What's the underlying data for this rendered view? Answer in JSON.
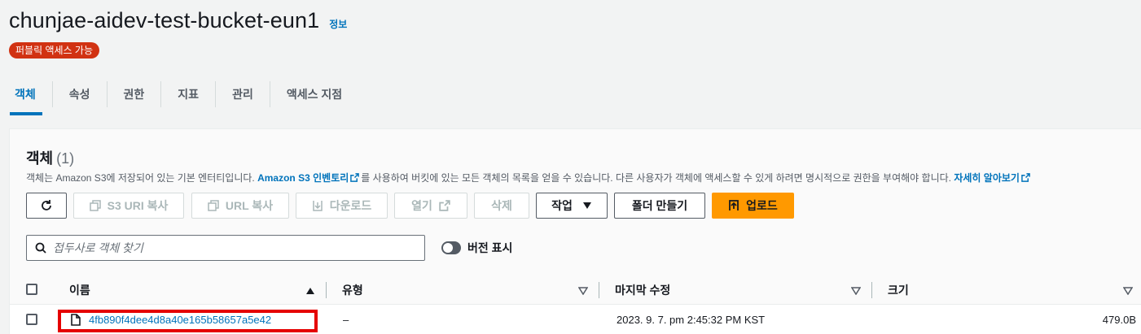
{
  "header": {
    "bucket_name": "chunjae-aidev-test-bucket-eun1",
    "info_link": "정보",
    "public_badge": "퍼블릭 액세스 가능"
  },
  "tabs": [
    {
      "label": "객체",
      "active": true
    },
    {
      "label": "속성"
    },
    {
      "label": "권한"
    },
    {
      "label": "지표"
    },
    {
      "label": "관리"
    },
    {
      "label": "액세스 지점"
    }
  ],
  "objects_panel": {
    "heading": "객체",
    "count": "(1)",
    "description_prefix": "객체는 Amazon S3에 저장되어 있는 기본 엔터티입니다. ",
    "inventory_link": "Amazon S3 인벤토리",
    "description_middle": "를 사용하여 버킷에 있는 모든 객체의 목록을 얻을 수 있습니다. 다른 사용자가 객체에 액세스할 수 있게 하려면 명시적으로 권한을 부여해야 합니다. ",
    "learn_more_link": "자세히 알아보기"
  },
  "toolbar": {
    "copy_s3_uri": "S3 URI 복사",
    "copy_url": "URL 복사",
    "download": "다운로드",
    "open": "열기",
    "delete": "삭제",
    "actions": "작업",
    "create_folder": "폴더 만들기",
    "upload": "업로드"
  },
  "search": {
    "placeholder": "접두사로 객체 찾기",
    "value": ""
  },
  "versions_toggle": {
    "label": "버전 표시",
    "enabled": false
  },
  "table": {
    "columns": [
      "이름",
      "유형",
      "마지막 수정",
      "크기"
    ],
    "rows": [
      {
        "name": "4fb890f4dee4d8a40e165b58657a5e42",
        "type": "–",
        "last_modified": "2023. 9. 7. pm 2:45:32 PM KST",
        "size": "479.0B"
      }
    ]
  },
  "colors": {
    "accent": "#0073bb",
    "primary_button": "#ff9900",
    "badge": "#d13212",
    "highlight_box": "#e50000"
  }
}
